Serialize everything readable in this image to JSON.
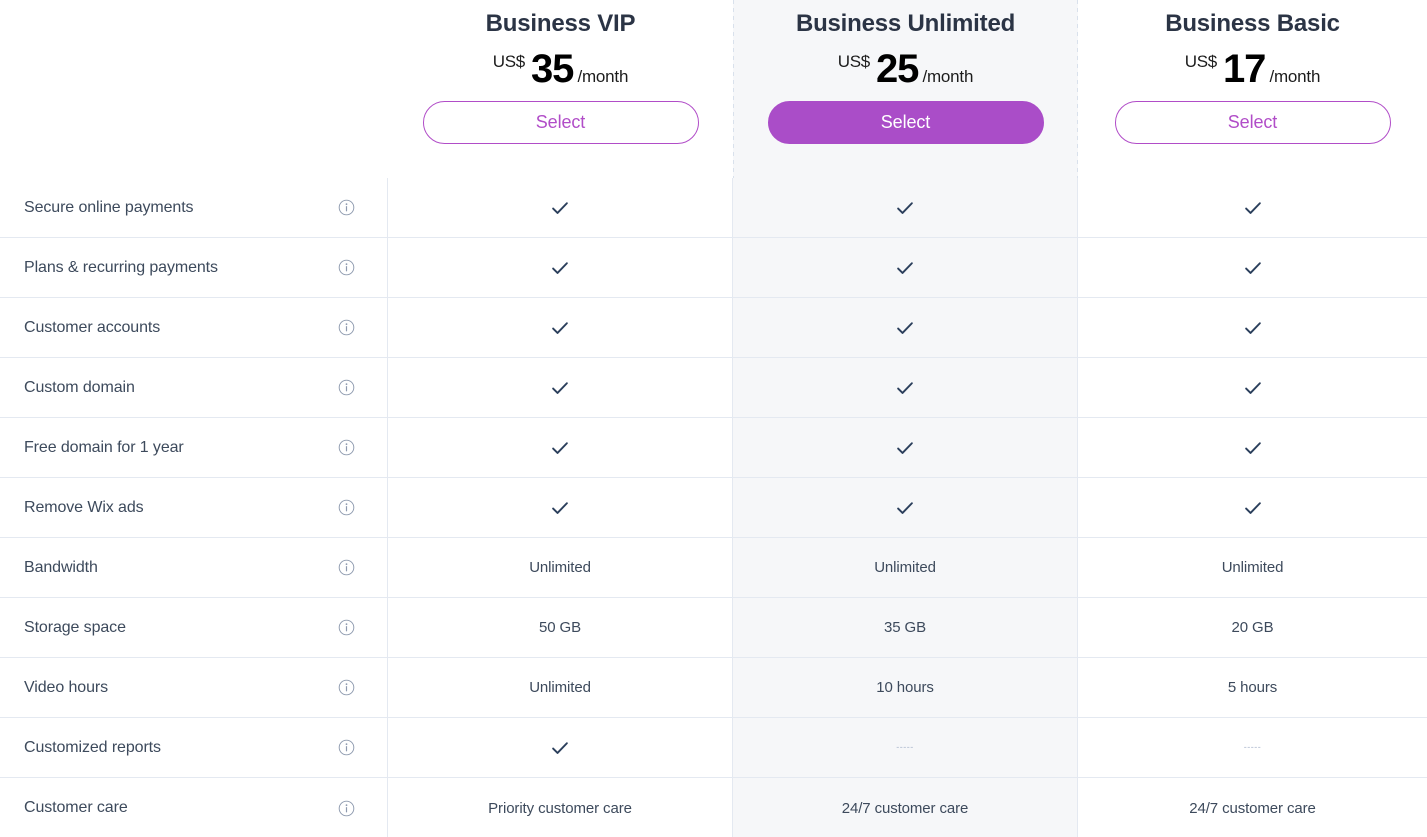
{
  "table": {
    "accent_color": "#b14dc8",
    "accent_filled_color": "#aa4dc8",
    "heading_color": "#2b3445",
    "body_text_color": "#3d4a5c",
    "highlight_column_bg": "#f6f7f9",
    "border_color": "#e4e9f1",
    "check_color": "#2b3f5c",
    "dash_color": "#aab6cc"
  },
  "plans": [
    {
      "name": "Business VIP",
      "currency": "US$",
      "amount": "35",
      "period": "/month",
      "select_label": "Select",
      "featured": false
    },
    {
      "name": "Business Unlimited",
      "currency": "US$",
      "amount": "25",
      "period": "/month",
      "select_label": "Select",
      "featured": true
    },
    {
      "name": "Business Basic",
      "currency": "US$",
      "amount": "17",
      "period": "/month",
      "select_label": "Select",
      "featured": false
    }
  ],
  "features": [
    {
      "label": "Secure online payments",
      "info_icon": "info-circle-icon",
      "values": [
        "check",
        "check",
        "check"
      ]
    },
    {
      "label": "Plans & recurring payments",
      "info_icon": "info-circle-icon",
      "values": [
        "check",
        "check",
        "check"
      ]
    },
    {
      "label": "Customer accounts",
      "info_icon": "info-circle-icon",
      "values": [
        "check",
        "check",
        "check"
      ]
    },
    {
      "label": "Custom domain",
      "info_icon": "info-circle-icon",
      "values": [
        "check",
        "check",
        "check"
      ]
    },
    {
      "label": "Free domain for 1 year",
      "info_icon": "info-circle-icon",
      "values": [
        "check",
        "check",
        "check"
      ]
    },
    {
      "label": "Remove Wix ads",
      "info_icon": "info-circle-icon",
      "values": [
        "check",
        "check",
        "check"
      ]
    },
    {
      "label": "Bandwidth",
      "info_icon": "info-circle-icon",
      "values": [
        "Unlimited",
        "Unlimited",
        "Unlimited"
      ]
    },
    {
      "label": "Storage space",
      "info_icon": "info-circle-icon",
      "values": [
        "50 GB",
        "35 GB",
        "20 GB"
      ]
    },
    {
      "label": "Video hours",
      "info_icon": "info-circle-icon",
      "values": [
        "Unlimited",
        "10 hours",
        "5 hours"
      ]
    },
    {
      "label": "Customized reports",
      "info_icon": "info-circle-icon",
      "values": [
        "check",
        "dash",
        "dash"
      ]
    },
    {
      "label": "Customer care",
      "info_icon": "info-circle-icon",
      "values": [
        "Priority customer care",
        "24/7 customer care",
        "24/7 customer care"
      ]
    }
  ],
  "dash_glyph": "-----"
}
